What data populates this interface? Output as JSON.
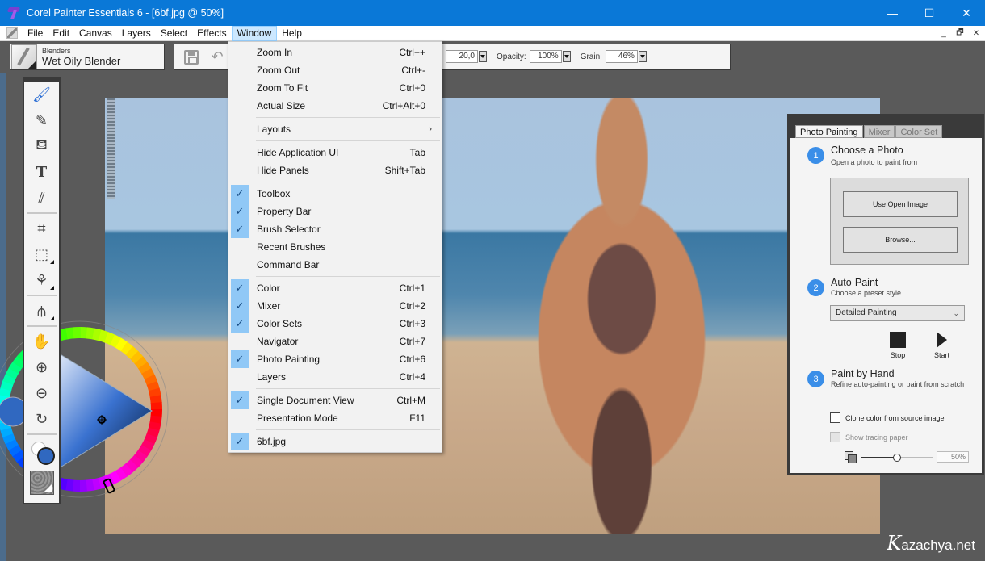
{
  "window": {
    "title": "Corel Painter Essentials 6 - [6bf.jpg @ 50%]",
    "controls": {
      "minimize": "—",
      "maximize": "☐",
      "close": "✕"
    },
    "mdi_controls": {
      "minimize": "_",
      "restore": "🗗",
      "close": "✕"
    }
  },
  "menubar": {
    "items": [
      "File",
      "Edit",
      "Canvas",
      "Layers",
      "Select",
      "Effects",
      "Window",
      "Help"
    ],
    "active": "Window"
  },
  "brush_selector": {
    "category": "Blenders",
    "variant": "Wet Oily Blender"
  },
  "property_bar": {
    "size_value": "20,0",
    "opacity_label": "Opacity:",
    "opacity_value": "100%",
    "grain_label": "Grain:",
    "grain_value": "46%"
  },
  "window_menu": {
    "groups": [
      [
        {
          "label": "Zoom In",
          "shortcut": "Ctrl++",
          "checked": false
        },
        {
          "label": "Zoom Out",
          "shortcut": "Ctrl+-",
          "checked": false
        },
        {
          "label": "Zoom To Fit",
          "shortcut": "Ctrl+0",
          "checked": false
        },
        {
          "label": "Actual Size",
          "shortcut": "Ctrl+Alt+0",
          "checked": false
        }
      ],
      [
        {
          "label": "Layouts",
          "shortcut": "",
          "checked": false,
          "submenu": true
        }
      ],
      [
        {
          "label": "Hide Application UI",
          "shortcut": "Tab",
          "checked": false
        },
        {
          "label": "Hide Panels",
          "shortcut": "Shift+Tab",
          "checked": false
        }
      ],
      [
        {
          "label": "Toolbox",
          "shortcut": "",
          "checked": true
        },
        {
          "label": "Property Bar",
          "shortcut": "",
          "checked": true
        },
        {
          "label": "Brush Selector",
          "shortcut": "",
          "checked": true
        },
        {
          "label": "Recent Brushes",
          "shortcut": "",
          "checked": false
        },
        {
          "label": "Command Bar",
          "shortcut": "",
          "checked": false
        }
      ],
      [
        {
          "label": "Color",
          "shortcut": "Ctrl+1",
          "checked": true
        },
        {
          "label": "Mixer",
          "shortcut": "Ctrl+2",
          "checked": true
        },
        {
          "label": "Color Sets",
          "shortcut": "Ctrl+3",
          "checked": true
        },
        {
          "label": "Navigator",
          "shortcut": "Ctrl+7",
          "checked": false
        },
        {
          "label": "Photo Painting",
          "shortcut": "Ctrl+6",
          "checked": true
        },
        {
          "label": "Layers",
          "shortcut": "Ctrl+4",
          "checked": false
        }
      ],
      [
        {
          "label": "Single Document View",
          "shortcut": "Ctrl+M",
          "checked": true
        },
        {
          "label": "Presentation Mode",
          "shortcut": "F11",
          "checked": false
        }
      ],
      [
        {
          "label": "6bf.jpg",
          "shortcut": "",
          "checked": true
        }
      ]
    ],
    "check_glyph": "✓",
    "submenu_glyph": "›"
  },
  "toolbox": {
    "tools": [
      {
        "name": "brush-tool",
        "glyph": "🖌",
        "active": true
      },
      {
        "name": "dropper-tool",
        "glyph": "⟋"
      },
      {
        "name": "paint-bucket-tool",
        "glyph": "⛾"
      },
      {
        "name": "text-tool",
        "glyph": "T"
      },
      {
        "name": "blender-tool",
        "glyph": "⫽"
      }
    ]
  },
  "color": {
    "main_hex": "#3068c0",
    "additional_hex": "#ffffff"
  },
  "photo_painting": {
    "tabs": [
      {
        "label": "Photo Painting",
        "active": true
      },
      {
        "label": "Mixer",
        "active": false
      },
      {
        "label": "Color Set",
        "active": false
      }
    ],
    "step1": {
      "num": "1",
      "title": "Choose a Photo",
      "subtitle": "Open a photo to paint from"
    },
    "use_open_image": "Use Open Image",
    "browse": "Browse...",
    "step2": {
      "num": "2",
      "title": "Auto-Paint",
      "subtitle": "Choose a preset style"
    },
    "preset": "Detailed Painting",
    "stop": "Stop",
    "start": "Start",
    "step3": {
      "num": "3",
      "title": "Paint by Hand",
      "subtitle": "Refine auto-painting or paint from scratch"
    },
    "clone_color": {
      "label": "Clone color from source image",
      "checked": false
    },
    "tracing_paper": {
      "label": "Show tracing paper",
      "checked": false,
      "enabled": false
    },
    "tracing_opacity_percent": 50,
    "tracing_opacity_label": "50%"
  },
  "watermark": {
    "k": "K",
    "rest": "azachya.net"
  }
}
